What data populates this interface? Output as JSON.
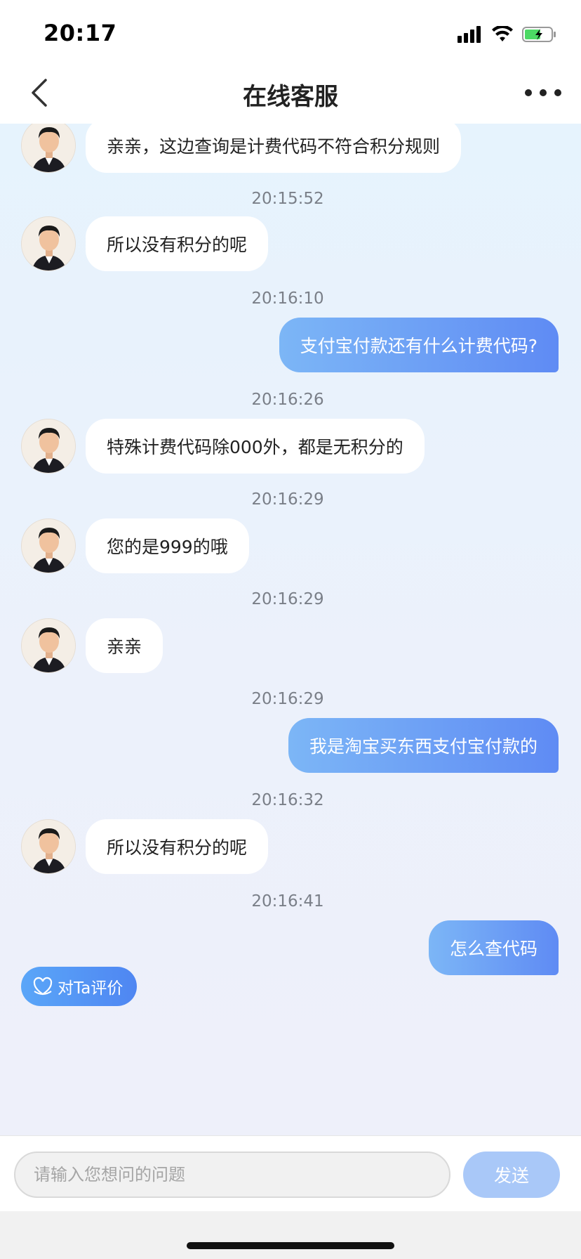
{
  "status_bar": {
    "time": "20:17"
  },
  "header": {
    "title": "在线客服"
  },
  "messages": [
    {
      "side": "in",
      "text": "亲亲，这边查询是计费代码不符合积分规则"
    },
    {
      "side": "time",
      "text": "20:15:52"
    },
    {
      "side": "in",
      "text": "所以没有积分的呢"
    },
    {
      "side": "time",
      "text": "20:16:10"
    },
    {
      "side": "out",
      "text": "支付宝付款还有什么计费代码?"
    },
    {
      "side": "time",
      "text": "20:16:26"
    },
    {
      "side": "in",
      "text": "特殊计费代码除000外，都是无积分的"
    },
    {
      "side": "time",
      "text": "20:16:29"
    },
    {
      "side": "in",
      "text": "您的是999的哦"
    },
    {
      "side": "time",
      "text": "20:16:29"
    },
    {
      "side": "in",
      "text": "亲亲"
    },
    {
      "side": "time",
      "text": "20:16:29"
    },
    {
      "side": "out",
      "text": "我是淘宝买东西支付宝付款的"
    },
    {
      "side": "time",
      "text": "20:16:32"
    },
    {
      "side": "in",
      "text": "所以没有积分的呢"
    },
    {
      "side": "time",
      "text": "20:16:41"
    },
    {
      "side": "out",
      "text": "怎么查代码"
    }
  ],
  "rate_button": {
    "label": "对Ta评价"
  },
  "input": {
    "placeholder": "请输入您想问的问题",
    "send_label": "发送"
  },
  "colors": {
    "accent": "#5f8bf4",
    "send_disabled": "#a9c8f8",
    "bubble_in": "#ffffff"
  },
  "icons": [
    "back-chevron-icon",
    "more-dots-icon",
    "signal-icon",
    "wifi-icon",
    "battery-charging-icon",
    "avatar-icon",
    "heart-shield-icon"
  ]
}
